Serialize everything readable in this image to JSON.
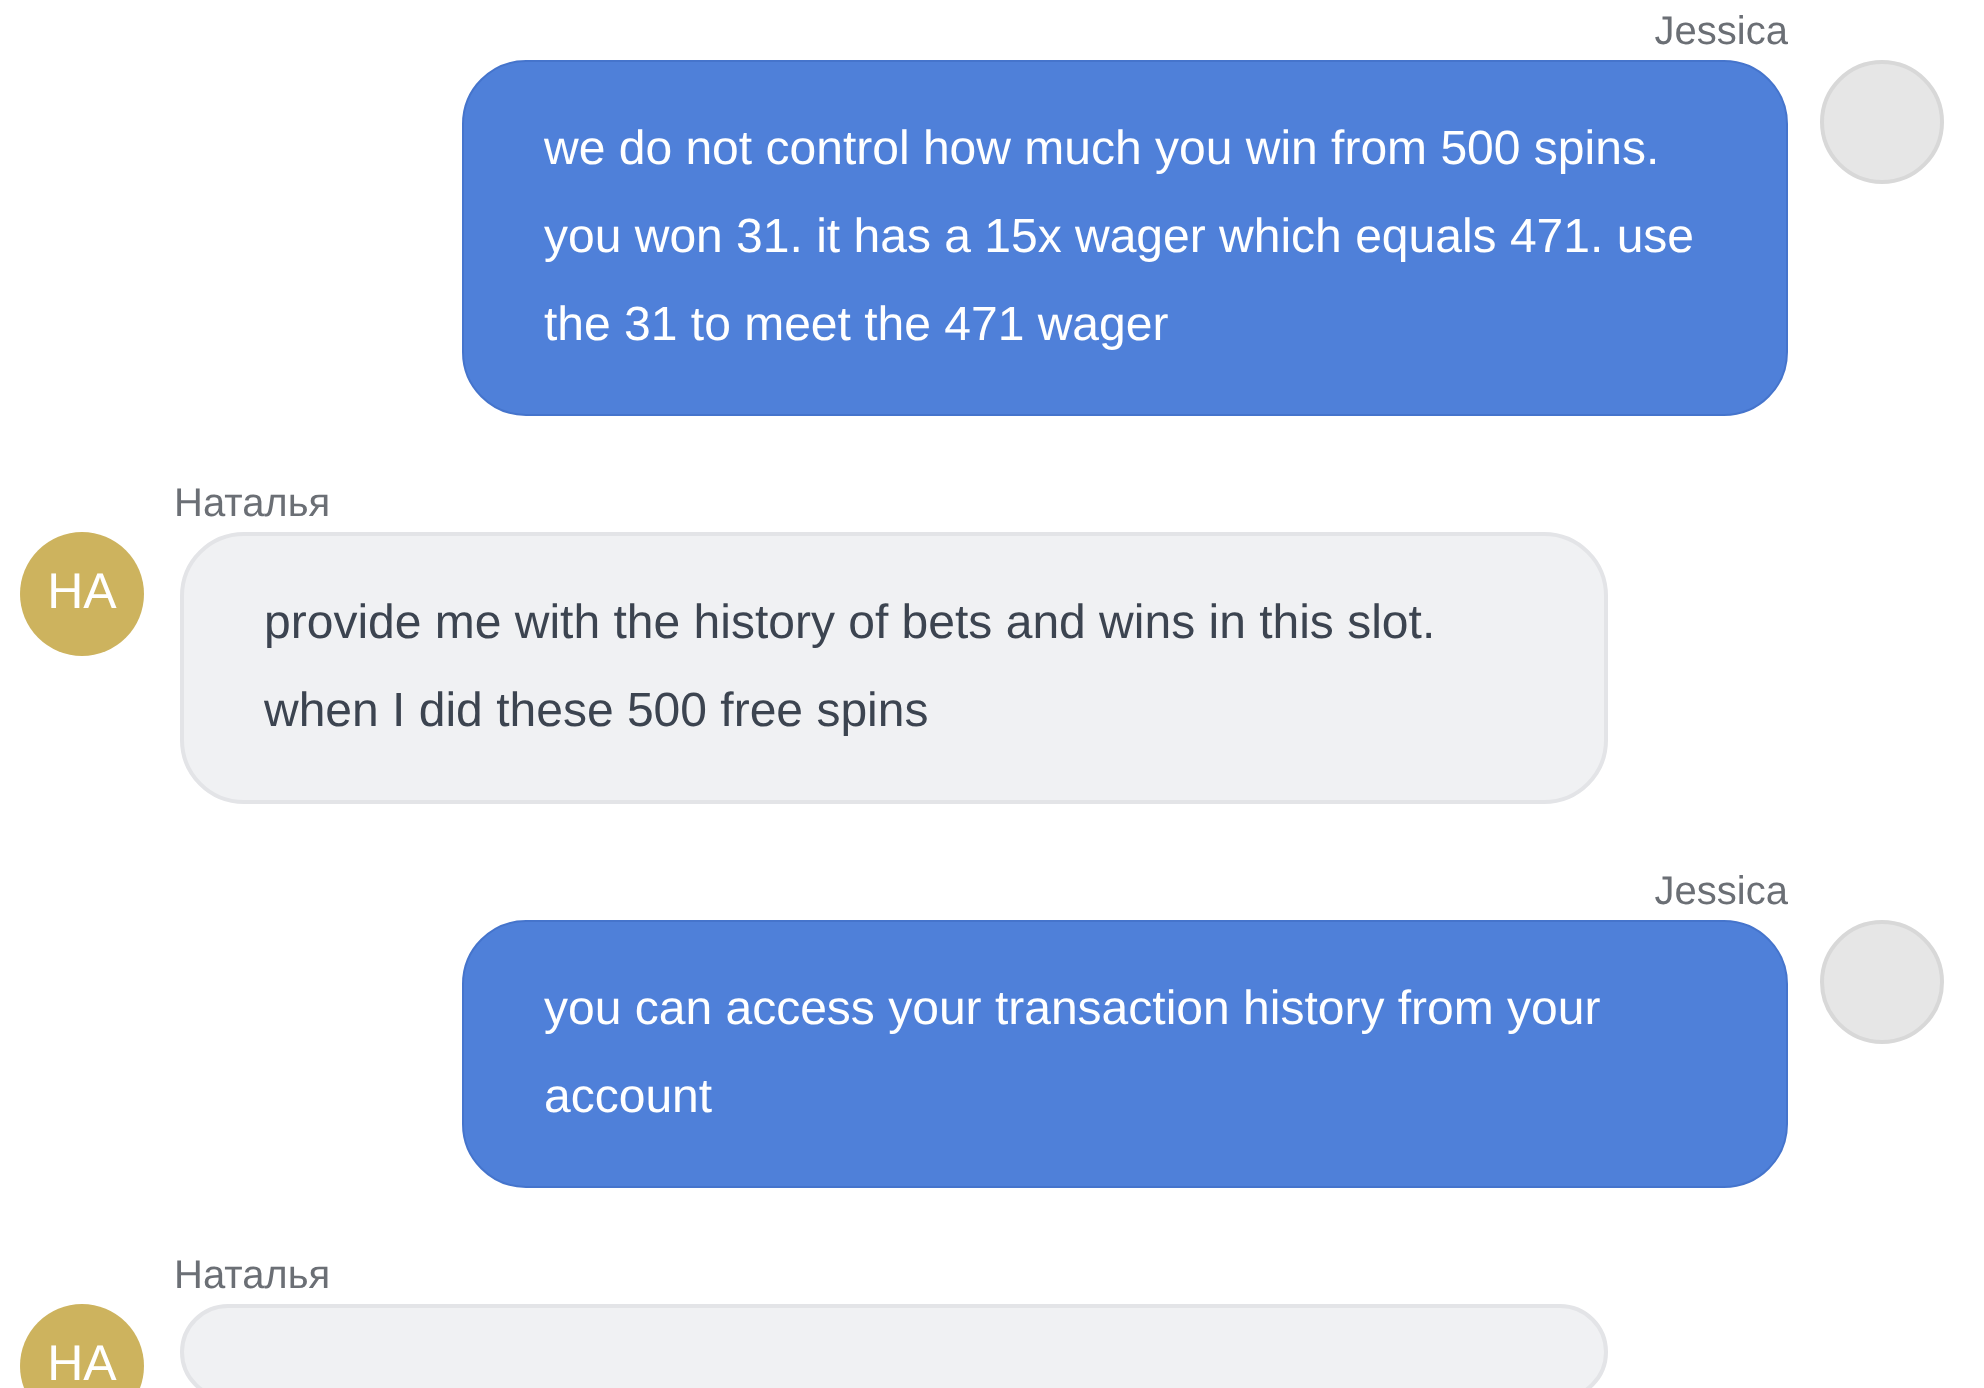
{
  "messages": [
    {
      "sender": "Jessica",
      "kind": "agent",
      "avatar": {
        "kind": "photo"
      },
      "text": "we do not control how much you win from 500 spins. you won 31. it has a 15x wager which equals 471. use the 31 to meet the 471 wager"
    },
    {
      "sender": "Наталья",
      "kind": "customer",
      "avatar": {
        "kind": "initials",
        "initials": "HA"
      },
      "text": "provide me with the history of bets and wins in this slot. when I did these 500 free spins"
    },
    {
      "sender": "Jessica",
      "kind": "agent",
      "avatar": {
        "kind": "photo"
      },
      "text": "you can access your transaction history from your account"
    },
    {
      "sender": "Наталья",
      "kind": "customer",
      "avatar": {
        "kind": "initials",
        "initials": "HA"
      }
    }
  ]
}
